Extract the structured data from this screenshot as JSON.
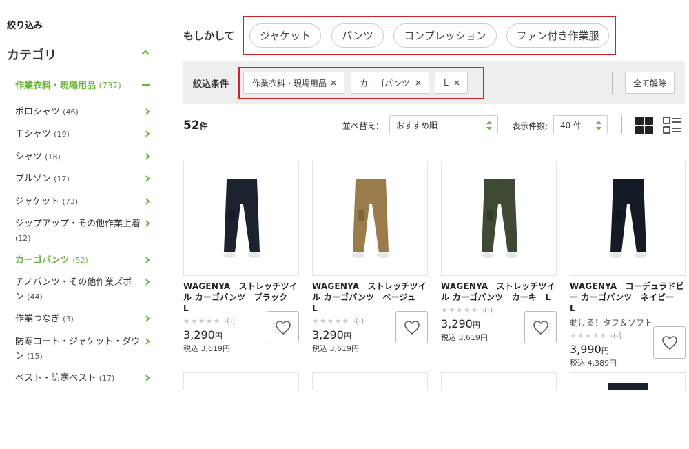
{
  "sidebar": {
    "heading": "絞り込み",
    "category_title": "カテゴリ",
    "parent": {
      "label": "作業衣料・現場用品",
      "count": "(737)"
    },
    "items": [
      {
        "label": "ポロシャツ",
        "count": "(46)"
      },
      {
        "label": "Ｔシャツ",
        "count": "(19)"
      },
      {
        "label": "シャツ",
        "count": "(18)"
      },
      {
        "label": "ブルゾン",
        "count": "(17)"
      },
      {
        "label": "ジャケット",
        "count": "(73)"
      },
      {
        "label": "ジップアップ・その他作業上着",
        "count": "(12)"
      },
      {
        "label": "カーゴパンツ",
        "count": "(52)"
      },
      {
        "label": "チノパンツ・その他作業ズボン",
        "count": "(44)"
      },
      {
        "label": "作業つなぎ",
        "count": "(3)"
      },
      {
        "label": "防寒コート・ジャケット・ダウン",
        "count": "(15)"
      },
      {
        "label": "ベスト・防寒ベスト",
        "count": "(17)"
      }
    ]
  },
  "suggest": {
    "label": "もしかして",
    "chips": [
      "ジャケット",
      "パンツ",
      "コンプレッション",
      "ファン付き作業服"
    ]
  },
  "filter": {
    "label": "絞込条件",
    "chips": [
      "作業衣料・現場用品",
      "カーゴパンツ",
      "L"
    ],
    "clear_label": "全て解除"
  },
  "toolbar": {
    "count": "52",
    "count_unit": "件",
    "sort_label": "並べ替え：",
    "sort_value": "おすすめ順",
    "perpage_label": "表示件数:",
    "perpage_value": "40 件"
  },
  "products": [
    {
      "name": "WAGENYA　ストレッチツイル カーゴパンツ　ブラック　L",
      "tag": "",
      "rating": "-(-)",
      "price": "3,290",
      "yen": "円",
      "tax": "税込 3,619円",
      "color": "#1c2230"
    },
    {
      "name": "WAGENYA　ストレッチツイル カーゴパンツ　ベージュ　L",
      "tag": "",
      "rating": "-(-)",
      "price": "3,290",
      "yen": "円",
      "tax": "税込 3,619円",
      "color": "#9a7b4c"
    },
    {
      "name": "WAGENYA　ストレッチツイル カーゴパンツ　カーキ　L",
      "tag": "",
      "rating": "-(-)",
      "price": "3,290",
      "yen": "円",
      "tax": "税込 3,619円",
      "color": "#3e4a33"
    },
    {
      "name": "WAGENYA　コーデュラドビー カーゴパンツ　ネイビー　L",
      "tag": "動ける！タフ＆ソフト",
      "rating": "-(-)",
      "price": "3,990",
      "yen": "円",
      "tax": "税込 4,389円",
      "color": "#141a26"
    }
  ],
  "colors": {
    "accent": "#6bb33a",
    "highlight": "#d42027",
    "filter_bg": "#eeeeee"
  }
}
